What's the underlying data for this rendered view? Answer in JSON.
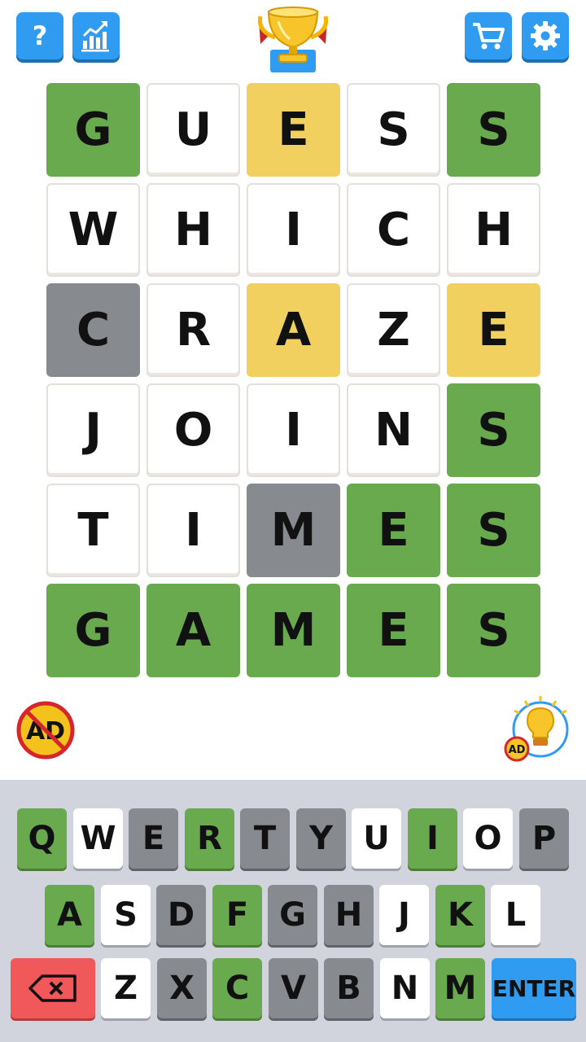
{
  "header": {
    "help_icon": "question-mark-icon",
    "stats_icon": "bar-chart-icon",
    "trophy_icon": "trophy-icon",
    "cart_icon": "shopping-cart-icon",
    "settings_icon": "gear-icon"
  },
  "board": {
    "rows": [
      [
        {
          "l": "G",
          "s": "correct"
        },
        {
          "l": "U",
          "s": "empty"
        },
        {
          "l": "E",
          "s": "present"
        },
        {
          "l": "S",
          "s": "empty"
        },
        {
          "l": "S",
          "s": "correct"
        }
      ],
      [
        {
          "l": "W",
          "s": "empty"
        },
        {
          "l": "H",
          "s": "empty"
        },
        {
          "l": "I",
          "s": "empty"
        },
        {
          "l": "C",
          "s": "empty"
        },
        {
          "l": "H",
          "s": "empty"
        }
      ],
      [
        {
          "l": "C",
          "s": "absent"
        },
        {
          "l": "R",
          "s": "empty"
        },
        {
          "l": "A",
          "s": "present"
        },
        {
          "l": "Z",
          "s": "empty"
        },
        {
          "l": "E",
          "s": "present"
        }
      ],
      [
        {
          "l": "J",
          "s": "empty"
        },
        {
          "l": "O",
          "s": "empty"
        },
        {
          "l": "I",
          "s": "empty"
        },
        {
          "l": "N",
          "s": "empty"
        },
        {
          "l": "S",
          "s": "correct"
        }
      ],
      [
        {
          "l": "T",
          "s": "empty"
        },
        {
          "l": "I",
          "s": "empty"
        },
        {
          "l": "M",
          "s": "absent"
        },
        {
          "l": "E",
          "s": "correct"
        },
        {
          "l": "S",
          "s": "correct"
        }
      ],
      [
        {
          "l": "G",
          "s": "correct"
        },
        {
          "l": "A",
          "s": "correct"
        },
        {
          "l": "M",
          "s": "correct"
        },
        {
          "l": "E",
          "s": "correct"
        },
        {
          "l": "S",
          "s": "correct"
        }
      ]
    ]
  },
  "no_ads": {
    "label": "AD"
  },
  "hint": {
    "badge": "AD"
  },
  "keyboard": {
    "rows": [
      [
        {
          "k": "Q",
          "s": "correct"
        },
        {
          "k": "W",
          "s": "unused"
        },
        {
          "k": "E",
          "s": "absent"
        },
        {
          "k": "R",
          "s": "correct"
        },
        {
          "k": "T",
          "s": "absent"
        },
        {
          "k": "Y",
          "s": "absent"
        },
        {
          "k": "U",
          "s": "unused"
        },
        {
          "k": "I",
          "s": "correct"
        },
        {
          "k": "O",
          "s": "unused"
        },
        {
          "k": "P",
          "s": "absent"
        }
      ],
      [
        {
          "k": "A",
          "s": "correct"
        },
        {
          "k": "S",
          "s": "unused"
        },
        {
          "k": "D",
          "s": "absent"
        },
        {
          "k": "F",
          "s": "correct"
        },
        {
          "k": "G",
          "s": "absent"
        },
        {
          "k": "H",
          "s": "absent"
        },
        {
          "k": "J",
          "s": "unused"
        },
        {
          "k": "K",
          "s": "correct"
        },
        {
          "k": "L",
          "s": "unused"
        }
      ],
      [
        {
          "k": "Z",
          "s": "unused"
        },
        {
          "k": "X",
          "s": "absent"
        },
        {
          "k": "C",
          "s": "correct"
        },
        {
          "k": "V",
          "s": "absent"
        },
        {
          "k": "B",
          "s": "absent"
        },
        {
          "k": "N",
          "s": "unused"
        },
        {
          "k": "M",
          "s": "correct"
        }
      ]
    ],
    "enter_label": "ENTER",
    "backspace_icon": "backspace-icon"
  },
  "colors": {
    "correct": "#6aaa4f",
    "present": "#f2d060",
    "absent": "#878a8f",
    "accent": "#2f9cf2",
    "delete": "#f0585a",
    "keyboard_bg": "#d1d4dc"
  }
}
